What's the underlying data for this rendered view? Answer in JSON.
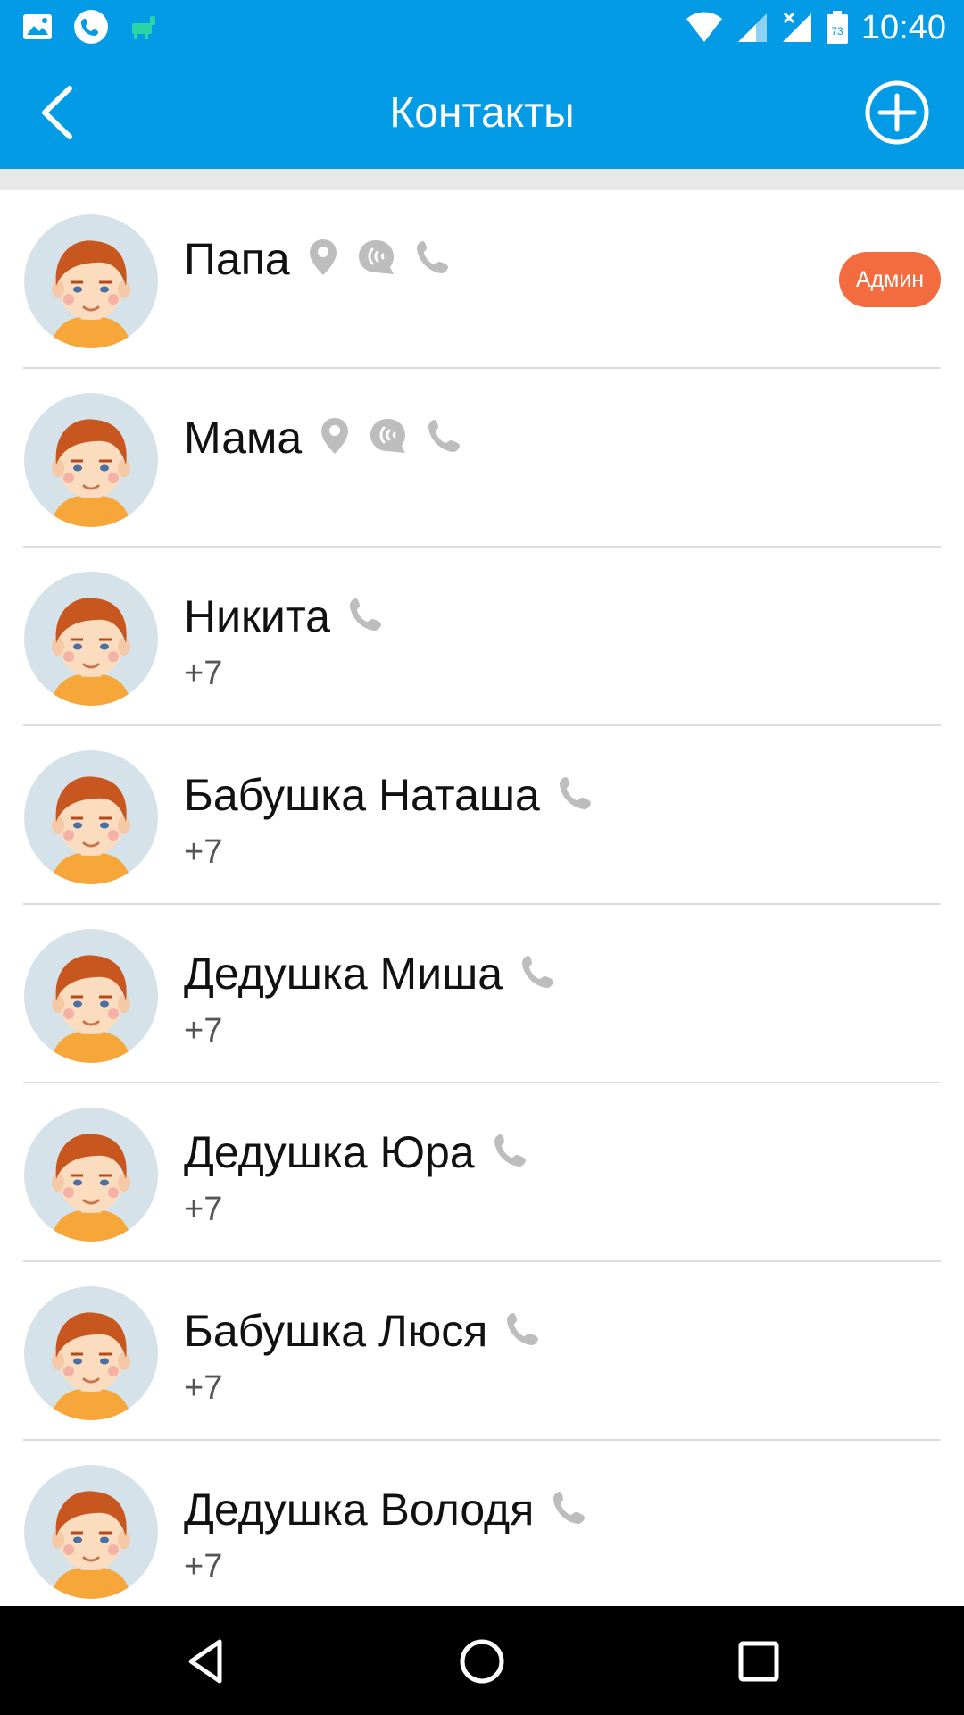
{
  "status_bar": {
    "time": "10:40",
    "battery_level": "73",
    "left_icons": [
      "image-icon",
      "phone-call-icon",
      "android-icon"
    ],
    "right_icons": [
      "wifi-icon",
      "signal-icon",
      "signal-x-icon",
      "battery-icon"
    ]
  },
  "toolbar": {
    "title": "Контакты",
    "back_icon": "chevron-left-icon",
    "add_icon": "plus-circle-icon"
  },
  "colors": {
    "primary": "#039be5",
    "badge": "#f26c3f",
    "icon_gray": "#bdbdbd"
  },
  "contacts": [
    {
      "name": "Папа",
      "phone": "",
      "badge": "Админ",
      "icons": [
        "location-icon",
        "chat-icon",
        "phone-icon"
      ]
    },
    {
      "name": "Мама",
      "phone": "",
      "badge": "",
      "icons": [
        "location-icon",
        "chat-icon",
        "phone-icon"
      ]
    },
    {
      "name": "Никита",
      "phone": "+7",
      "badge": "",
      "icons": [
        "phone-icon"
      ]
    },
    {
      "name": "Бабушка Наташа",
      "phone": "+7",
      "badge": "",
      "icons": [
        "phone-icon"
      ]
    },
    {
      "name": "Дедушка Миша",
      "phone": "+7",
      "badge": "",
      "icons": [
        "phone-icon"
      ]
    },
    {
      "name": "Дедушка Юра",
      "phone": "+7",
      "badge": "",
      "icons": [
        "phone-icon"
      ]
    },
    {
      "name": "Бабушка Люся",
      "phone": "+7",
      "badge": "",
      "icons": [
        "phone-icon"
      ]
    },
    {
      "name": "Дедушка Володя",
      "phone": "+7",
      "badge": "",
      "icons": [
        "phone-icon"
      ]
    }
  ],
  "nav_bar": {
    "buttons": [
      "back-triangle-icon",
      "home-circle-icon",
      "recents-square-icon"
    ]
  }
}
